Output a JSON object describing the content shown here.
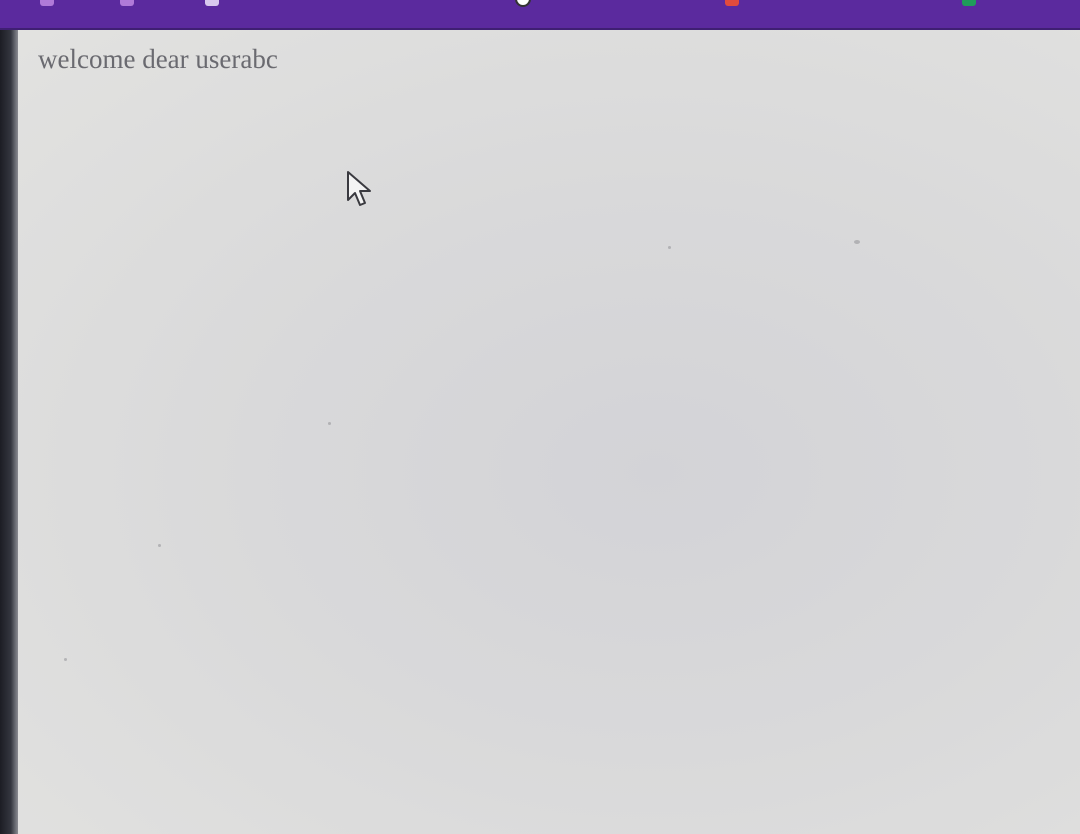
{
  "browser": {
    "tabs": [
      {
        "label": "",
        "favicon": "purple-favicon-icon",
        "color": "#b07ad8"
      },
      {
        "label": "",
        "favicon": "purple-favicon-icon",
        "color": "#b07ad8"
      },
      {
        "label": "",
        "favicon": "generic-favicon-icon",
        "color": "#d8c8ee"
      },
      {
        "label": "",
        "favicon": "clock-favicon-icon",
        "color": "#ffffff"
      },
      {
        "label": "",
        "favicon": "red-favicon-icon",
        "color": "#e24b3c"
      },
      {
        "label": "",
        "favicon": "green-favicon-icon",
        "color": "#1f9c5a"
      }
    ],
    "chrome_color": "#5b2a9e"
  },
  "page": {
    "welcome_text": "welcome dear userabc",
    "text_color": "#6a6a70",
    "background_color": "#d9d9da"
  },
  "cursor": {
    "icon": "mouse-pointer-icon"
  }
}
